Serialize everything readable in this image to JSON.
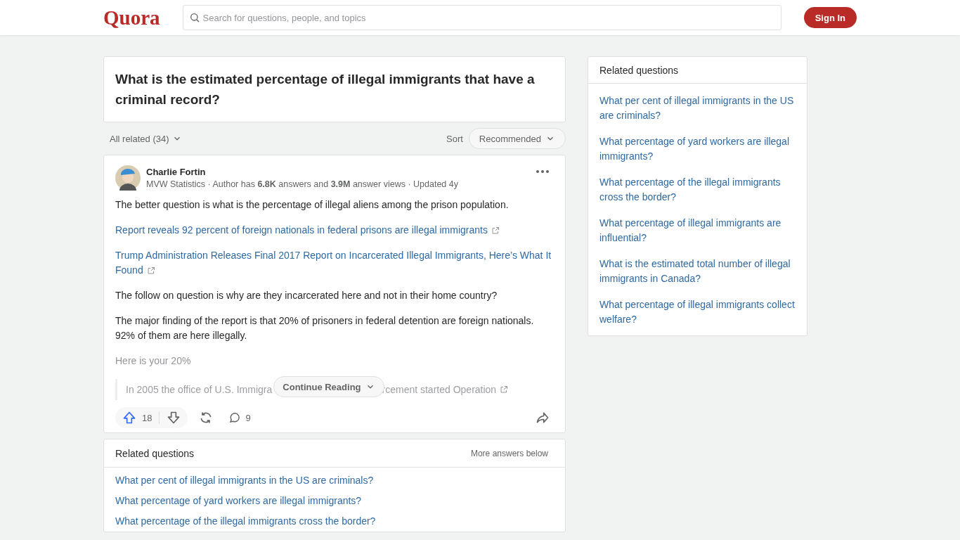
{
  "header": {
    "logo": "Quora",
    "search_placeholder": "Search for questions, people, and topics",
    "sign_in": "Sign In"
  },
  "question": {
    "title": "What is the estimated percentage of illegal immigrants that have a criminal record?"
  },
  "filter": {
    "all_related": "All related (34)",
    "sort_label": "Sort",
    "sort_value": "Recommended"
  },
  "answer": {
    "author": "Charlie Fortin",
    "meta": "MVW Statistics · Author has **6.8K** answers and **3.9M** answer views · Updated 4y",
    "paragraphs": [
      {
        "kind": "text",
        "text": "The better question is what is the percentage of illegal aliens among the prison population."
      },
      {
        "kind": "link",
        "text": "Report reveals 92 percent of foreign nationals in federal prisons are illegal immigrants"
      },
      {
        "kind": "link",
        "text": "Trump Administration Releases Final 2017 Report on Incarcerated Illegal Immigrants, Here’s What It Found"
      },
      {
        "kind": "text",
        "text": "The follow on question is why are they incarcerated here and not in their home country?"
      },
      {
        "kind": "text",
        "text": "The major finding of the report is that 20% of prisoners in federal detention are foreign nationals. 92% of them are here illegally."
      },
      {
        "kind": "faded",
        "text": "Here is your 20%"
      }
    ],
    "quote_before": "In 2005 the office of U.S. Immigra",
    "quote_after": "rcement started Operation",
    "continue": "Continue Reading",
    "upvotes": "18",
    "comments": "9"
  },
  "related_bottom": {
    "title": "Related questions",
    "more": "More answers below",
    "items": [
      "What per cent of illegal immigrants in the US are criminals?",
      "What percentage of yard workers are illegal immigrants?",
      "What percentage of the illegal immigrants cross the border?"
    ]
  },
  "related_side": {
    "title": "Related questions",
    "items": [
      "What per cent of illegal immigrants in the US are criminals?",
      "What percentage of yard workers are illegal immigrants?",
      "What percentage of the illegal immigrants cross the border?",
      "What percentage of illegal immigrants are influential?",
      "What is the estimated total number of illegal immigrants in Canada?",
      "What percentage of illegal immigrants collect welfare?"
    ]
  }
}
